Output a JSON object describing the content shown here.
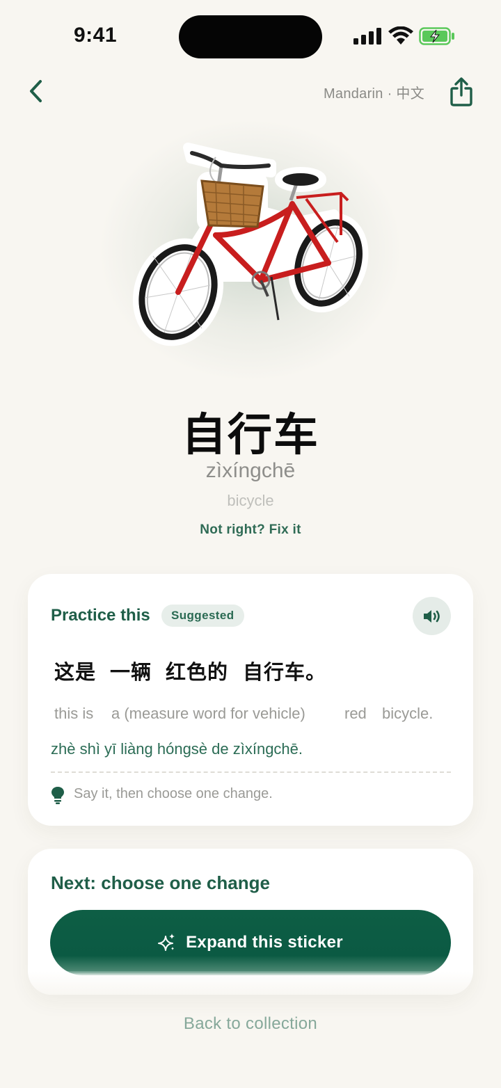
{
  "status_bar": {
    "time": "9:41"
  },
  "header": {
    "language": "Mandarin · 中文",
    "back_icon": "chevron-left-icon",
    "share_icon": "share-icon"
  },
  "sticker": {
    "subject": "red bicycle with wicker basket",
    "icon": "bicycle-sticker"
  },
  "word": {
    "hanzi": "自行车",
    "pinyin": "zìxíngchē",
    "meaning": "bicycle",
    "fix_label": "Not right? Fix it"
  },
  "practice": {
    "title": "Practice this",
    "badge": "Suggested",
    "speaker_icon": "speaker-icon",
    "words": [
      {
        "hanzi": "这是",
        "gloss": "this is"
      },
      {
        "hanzi": "一辆",
        "gloss": "a (measure word for vehicle)"
      },
      {
        "hanzi": "红色的",
        "gloss": "red"
      },
      {
        "hanzi": "自行车。",
        "gloss": "bicycle."
      }
    ],
    "pinyin": "zhè shì yī liàng hóngsè de zìxíngchē.",
    "tip": "Say it, then choose one change.",
    "tip_icon": "lightbulb-icon"
  },
  "next": {
    "title": "Next: choose one change",
    "button_label": "Expand this sticker",
    "button_icon": "sparkles-icon"
  },
  "footer": {
    "back_label": "Back to collection"
  },
  "colors": {
    "background": "#f8f6f1",
    "accent": "#0e5e45",
    "accent_text": "#1f5e48",
    "muted": "#9a9a96"
  }
}
